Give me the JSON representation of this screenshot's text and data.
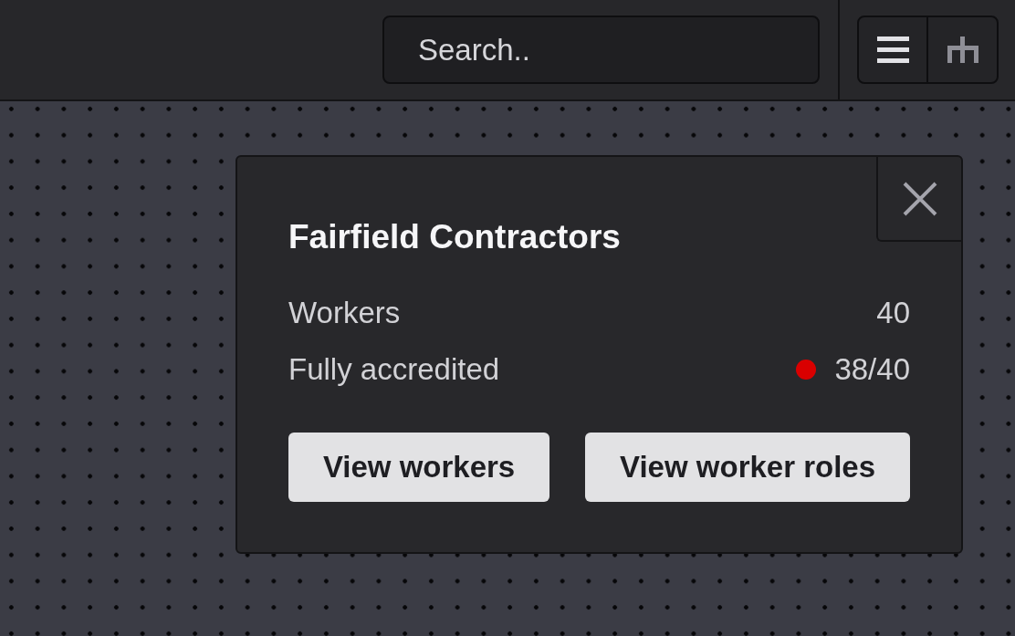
{
  "search": {
    "placeholder": "Search.."
  },
  "popup": {
    "title": "Fairfield Contractors",
    "rows": [
      {
        "label": "Workers",
        "value": "40"
      },
      {
        "label": "Fully accredited",
        "value": "38/40",
        "color": "#d90000"
      }
    ],
    "buttons": [
      "View workers",
      "View worker roles"
    ]
  }
}
